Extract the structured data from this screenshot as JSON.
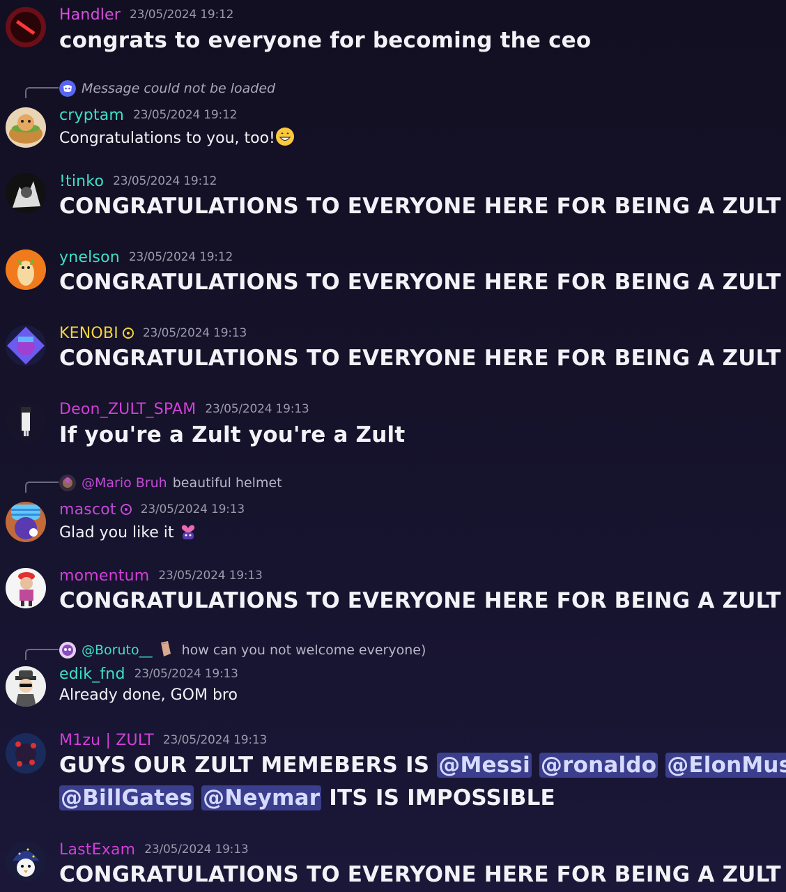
{
  "colors": {
    "handler": "#d64fe0",
    "teal": "#3ee0c8",
    "yellow": "#f4d43b",
    "purple": "#c24bd6",
    "magenta": "#d33fd8",
    "timestamp": "#9b9aaa",
    "mention_bg": "#3a3e8c"
  },
  "messages": [
    {
      "id": "handler",
      "user": "Handler",
      "time": "23/05/2024 19:12",
      "text": "congrats to everyone for becoming the ceo"
    },
    {
      "id": "cryptam",
      "reply_text": "Message could not be loaded",
      "user": "cryptam",
      "time": "23/05/2024 19:12",
      "text": "Congratulations to you, too!",
      "emoji": "grinning-face-emoji"
    },
    {
      "id": "tinko",
      "user": "!tinko",
      "time": "23/05/2024 19:12",
      "text": "CONGRATULATIONS TO EVERYONE HERE FOR BEING A ZULT"
    },
    {
      "id": "ynelson",
      "user": "ynelson",
      "time": "23/05/2024 19:12",
      "text": "CONGRATULATIONS TO EVERYONE HERE FOR BEING A ZULT"
    },
    {
      "id": "kenobi",
      "user": "KENOBI",
      "time": "23/05/2024 19:13",
      "text": "CONGRATULATIONS TO EVERYONE HERE FOR BEING A ZULT"
    },
    {
      "id": "deon",
      "user": "Deon_ZULT_SPAM",
      "time": "23/05/2024 19:13",
      "text": "If you're a Zult you're a Zult"
    },
    {
      "id": "mascot",
      "reply_user": "@Mario Bruh",
      "reply_text": "beautiful helmet",
      "user": "mascot",
      "time": "23/05/2024 19:13",
      "text": "Glad you like it",
      "emoji": "heart-character-emoji"
    },
    {
      "id": "momentum",
      "user": "momentum",
      "time": "23/05/2024 19:13",
      "text": "CONGRATULATIONS TO EVERYONE HERE FOR BEING A ZULT"
    },
    {
      "id": "edik",
      "reply_user": "@Boruto__",
      "reply_text": "how can you not welcome everyone)",
      "user": "edik_fnd",
      "time": "23/05/2024 19:13",
      "text": "Already done, GOM bro"
    },
    {
      "id": "m1zu",
      "user": "M1zu | ZULT",
      "time": "23/05/2024 19:13",
      "line1_prefix": "GUYS OUR ZULT MEMEBERS IS",
      "mentions": [
        "@Messi",
        "@ronaldo",
        "@ElonMusk",
        "@BillGates",
        "@Neymar"
      ],
      "line2_suffix": "ITS IS IMPOSSIBLE"
    },
    {
      "id": "lastexam",
      "user": "LastExam",
      "time": "23/05/2024 19:13",
      "text": "CONGRATULATIONS TO EVERYONE HERE FOR BEING A ZULT"
    }
  ]
}
